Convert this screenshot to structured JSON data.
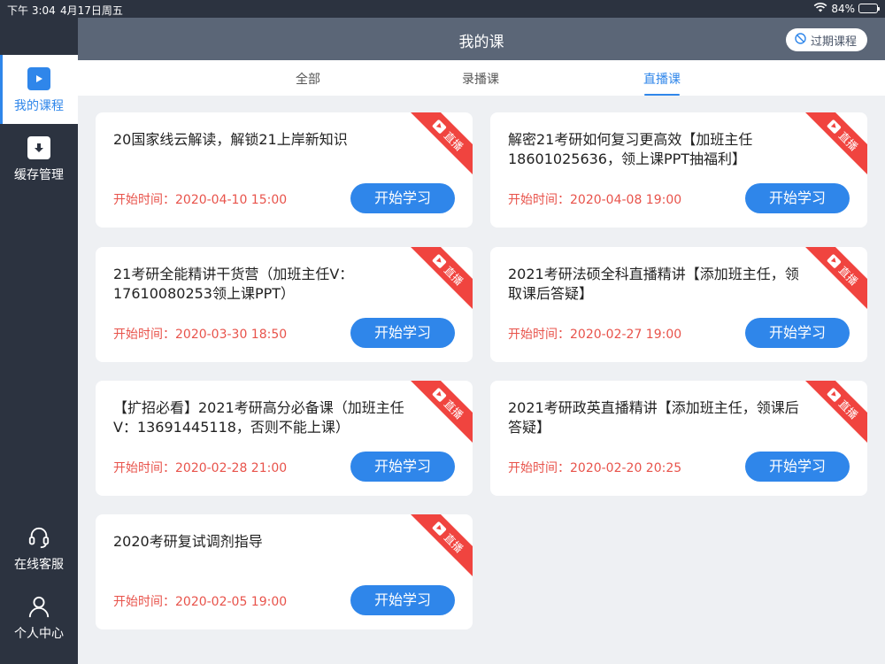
{
  "status_bar": {
    "time": "下午 3:04",
    "date": "4月17日周五",
    "battery": "84%",
    "battery_level": 0.84
  },
  "sidebar": {
    "items": [
      {
        "label": "我的课程",
        "icon": "play-icon",
        "active": true
      },
      {
        "label": "缓存管理",
        "icon": "download-icon",
        "active": false
      },
      {
        "label": "在线客服",
        "icon": "headset-icon",
        "active": false
      },
      {
        "label": "个人中心",
        "icon": "user-icon",
        "active": false
      }
    ]
  },
  "header": {
    "title": "我的课",
    "expired_label": "过期课程"
  },
  "tabs": [
    {
      "label": "全部",
      "active": false
    },
    {
      "label": "录播课",
      "active": false
    },
    {
      "label": "直播课",
      "active": true
    }
  ],
  "courses": [
    {
      "title": "20国家线云解读，解锁21上岸新知识",
      "time": "开始时间：2020-04-10 15:00",
      "button": "开始学习",
      "badge": "直播"
    },
    {
      "title": "解密21考研如何复习更高效【加班主任18601025636，领上课PPT抽福利】",
      "time": "开始时间：2020-04-08 19:00",
      "button": "开始学习",
      "badge": "直播"
    },
    {
      "title": "21考研全能精讲干货营（加班主任V：17610080253领上课PPT）",
      "time": "开始时间：2020-03-30 18:50",
      "button": "开始学习",
      "badge": "直播"
    },
    {
      "title": "2021考研法硕全科直播精讲【添加班主任，领取课后答疑】",
      "time": "开始时间：2020-02-27 19:00",
      "button": "开始学习",
      "badge": "直播"
    },
    {
      "title": "【扩招必看】2021考研高分必备课（加班主任V：13691445118，否则不能上课）",
      "time": "开始时间：2020-02-28 21:00",
      "button": "开始学习",
      "badge": "直播"
    },
    {
      "title": "2021考研政英直播精讲【添加班主任，领课后答疑】",
      "time": "开始时间：2020-02-20 20:25",
      "button": "开始学习",
      "badge": "直播"
    },
    {
      "title": "2020考研复试调剂指导",
      "time": "开始时间：2020-02-05 19:00",
      "button": "开始学习",
      "badge": "直播"
    }
  ],
  "colors": {
    "accent": "#2f86ea",
    "sidebar_bg": "#2c3340",
    "header_bg": "#5b6677",
    "time_red": "#e8534b",
    "ribbon_red": "#f0443f"
  }
}
